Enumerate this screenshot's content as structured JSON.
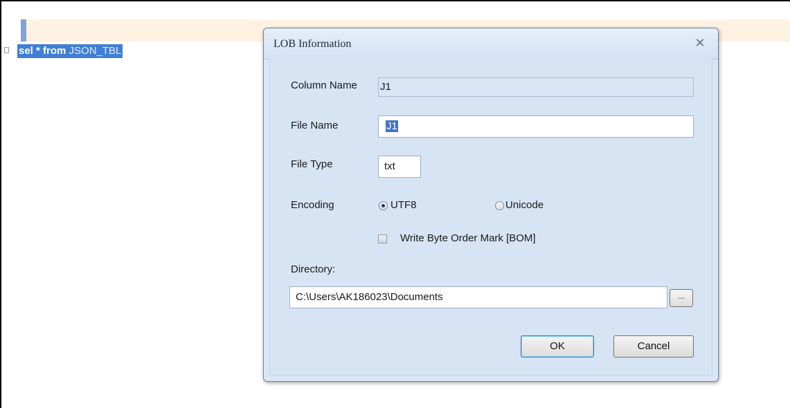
{
  "editor": {
    "sql_keyword": "sel * from",
    "sql_table": "JSON_TBL"
  },
  "dialog": {
    "title": "LOB Information",
    "close_glyph": "✕",
    "column_name_label": "Column Name",
    "column_name_value": "J1",
    "file_name_label": "File Name",
    "file_name_value": "J1",
    "file_type_label": "File Type",
    "file_type_value": "txt",
    "encoding_label": "Encoding",
    "encoding_options": [
      "UTF8",
      "Unicode"
    ],
    "encoding_selected": "UTF8",
    "bom_label": "Write Byte Order Mark [BOM]",
    "bom_checked": false,
    "directory_label": "Directory:",
    "directory_value": "C:\\Users\\AK186023\\Documents",
    "browse_label": "...",
    "ok_label": "OK",
    "cancel_label": "Cancel"
  }
}
